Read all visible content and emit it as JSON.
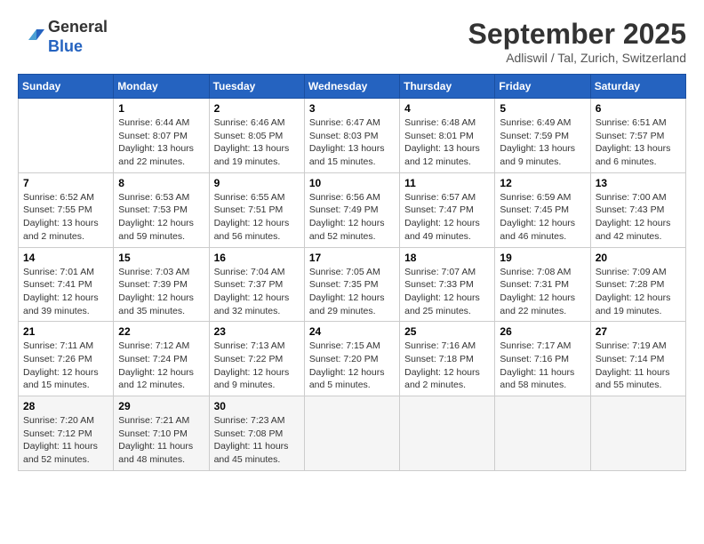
{
  "header": {
    "logo_line1": "General",
    "logo_line2": "Blue",
    "month_title": "September 2025",
    "location": "Adliswil / Tal, Zurich, Switzerland"
  },
  "days_of_week": [
    "Sunday",
    "Monday",
    "Tuesday",
    "Wednesday",
    "Thursday",
    "Friday",
    "Saturday"
  ],
  "weeks": [
    [
      {
        "day": "",
        "info": ""
      },
      {
        "day": "1",
        "info": "Sunrise: 6:44 AM\nSunset: 8:07 PM\nDaylight: 13 hours\nand 22 minutes."
      },
      {
        "day": "2",
        "info": "Sunrise: 6:46 AM\nSunset: 8:05 PM\nDaylight: 13 hours\nand 19 minutes."
      },
      {
        "day": "3",
        "info": "Sunrise: 6:47 AM\nSunset: 8:03 PM\nDaylight: 13 hours\nand 15 minutes."
      },
      {
        "day": "4",
        "info": "Sunrise: 6:48 AM\nSunset: 8:01 PM\nDaylight: 13 hours\nand 12 minutes."
      },
      {
        "day": "5",
        "info": "Sunrise: 6:49 AM\nSunset: 7:59 PM\nDaylight: 13 hours\nand 9 minutes."
      },
      {
        "day": "6",
        "info": "Sunrise: 6:51 AM\nSunset: 7:57 PM\nDaylight: 13 hours\nand 6 minutes."
      }
    ],
    [
      {
        "day": "7",
        "info": "Sunrise: 6:52 AM\nSunset: 7:55 PM\nDaylight: 13 hours\nand 2 minutes."
      },
      {
        "day": "8",
        "info": "Sunrise: 6:53 AM\nSunset: 7:53 PM\nDaylight: 12 hours\nand 59 minutes."
      },
      {
        "day": "9",
        "info": "Sunrise: 6:55 AM\nSunset: 7:51 PM\nDaylight: 12 hours\nand 56 minutes."
      },
      {
        "day": "10",
        "info": "Sunrise: 6:56 AM\nSunset: 7:49 PM\nDaylight: 12 hours\nand 52 minutes."
      },
      {
        "day": "11",
        "info": "Sunrise: 6:57 AM\nSunset: 7:47 PM\nDaylight: 12 hours\nand 49 minutes."
      },
      {
        "day": "12",
        "info": "Sunrise: 6:59 AM\nSunset: 7:45 PM\nDaylight: 12 hours\nand 46 minutes."
      },
      {
        "day": "13",
        "info": "Sunrise: 7:00 AM\nSunset: 7:43 PM\nDaylight: 12 hours\nand 42 minutes."
      }
    ],
    [
      {
        "day": "14",
        "info": "Sunrise: 7:01 AM\nSunset: 7:41 PM\nDaylight: 12 hours\nand 39 minutes."
      },
      {
        "day": "15",
        "info": "Sunrise: 7:03 AM\nSunset: 7:39 PM\nDaylight: 12 hours\nand 35 minutes."
      },
      {
        "day": "16",
        "info": "Sunrise: 7:04 AM\nSunset: 7:37 PM\nDaylight: 12 hours\nand 32 minutes."
      },
      {
        "day": "17",
        "info": "Sunrise: 7:05 AM\nSunset: 7:35 PM\nDaylight: 12 hours\nand 29 minutes."
      },
      {
        "day": "18",
        "info": "Sunrise: 7:07 AM\nSunset: 7:33 PM\nDaylight: 12 hours\nand 25 minutes."
      },
      {
        "day": "19",
        "info": "Sunrise: 7:08 AM\nSunset: 7:31 PM\nDaylight: 12 hours\nand 22 minutes."
      },
      {
        "day": "20",
        "info": "Sunrise: 7:09 AM\nSunset: 7:28 PM\nDaylight: 12 hours\nand 19 minutes."
      }
    ],
    [
      {
        "day": "21",
        "info": "Sunrise: 7:11 AM\nSunset: 7:26 PM\nDaylight: 12 hours\nand 15 minutes."
      },
      {
        "day": "22",
        "info": "Sunrise: 7:12 AM\nSunset: 7:24 PM\nDaylight: 12 hours\nand 12 minutes."
      },
      {
        "day": "23",
        "info": "Sunrise: 7:13 AM\nSunset: 7:22 PM\nDaylight: 12 hours\nand 9 minutes."
      },
      {
        "day": "24",
        "info": "Sunrise: 7:15 AM\nSunset: 7:20 PM\nDaylight: 12 hours\nand 5 minutes."
      },
      {
        "day": "25",
        "info": "Sunrise: 7:16 AM\nSunset: 7:18 PM\nDaylight: 12 hours\nand 2 minutes."
      },
      {
        "day": "26",
        "info": "Sunrise: 7:17 AM\nSunset: 7:16 PM\nDaylight: 11 hours\nand 58 minutes."
      },
      {
        "day": "27",
        "info": "Sunrise: 7:19 AM\nSunset: 7:14 PM\nDaylight: 11 hours\nand 55 minutes."
      }
    ],
    [
      {
        "day": "28",
        "info": "Sunrise: 7:20 AM\nSunset: 7:12 PM\nDaylight: 11 hours\nand 52 minutes."
      },
      {
        "day": "29",
        "info": "Sunrise: 7:21 AM\nSunset: 7:10 PM\nDaylight: 11 hours\nand 48 minutes."
      },
      {
        "day": "30",
        "info": "Sunrise: 7:23 AM\nSunset: 7:08 PM\nDaylight: 11 hours\nand 45 minutes."
      },
      {
        "day": "",
        "info": ""
      },
      {
        "day": "",
        "info": ""
      },
      {
        "day": "",
        "info": ""
      },
      {
        "day": "",
        "info": ""
      }
    ]
  ]
}
